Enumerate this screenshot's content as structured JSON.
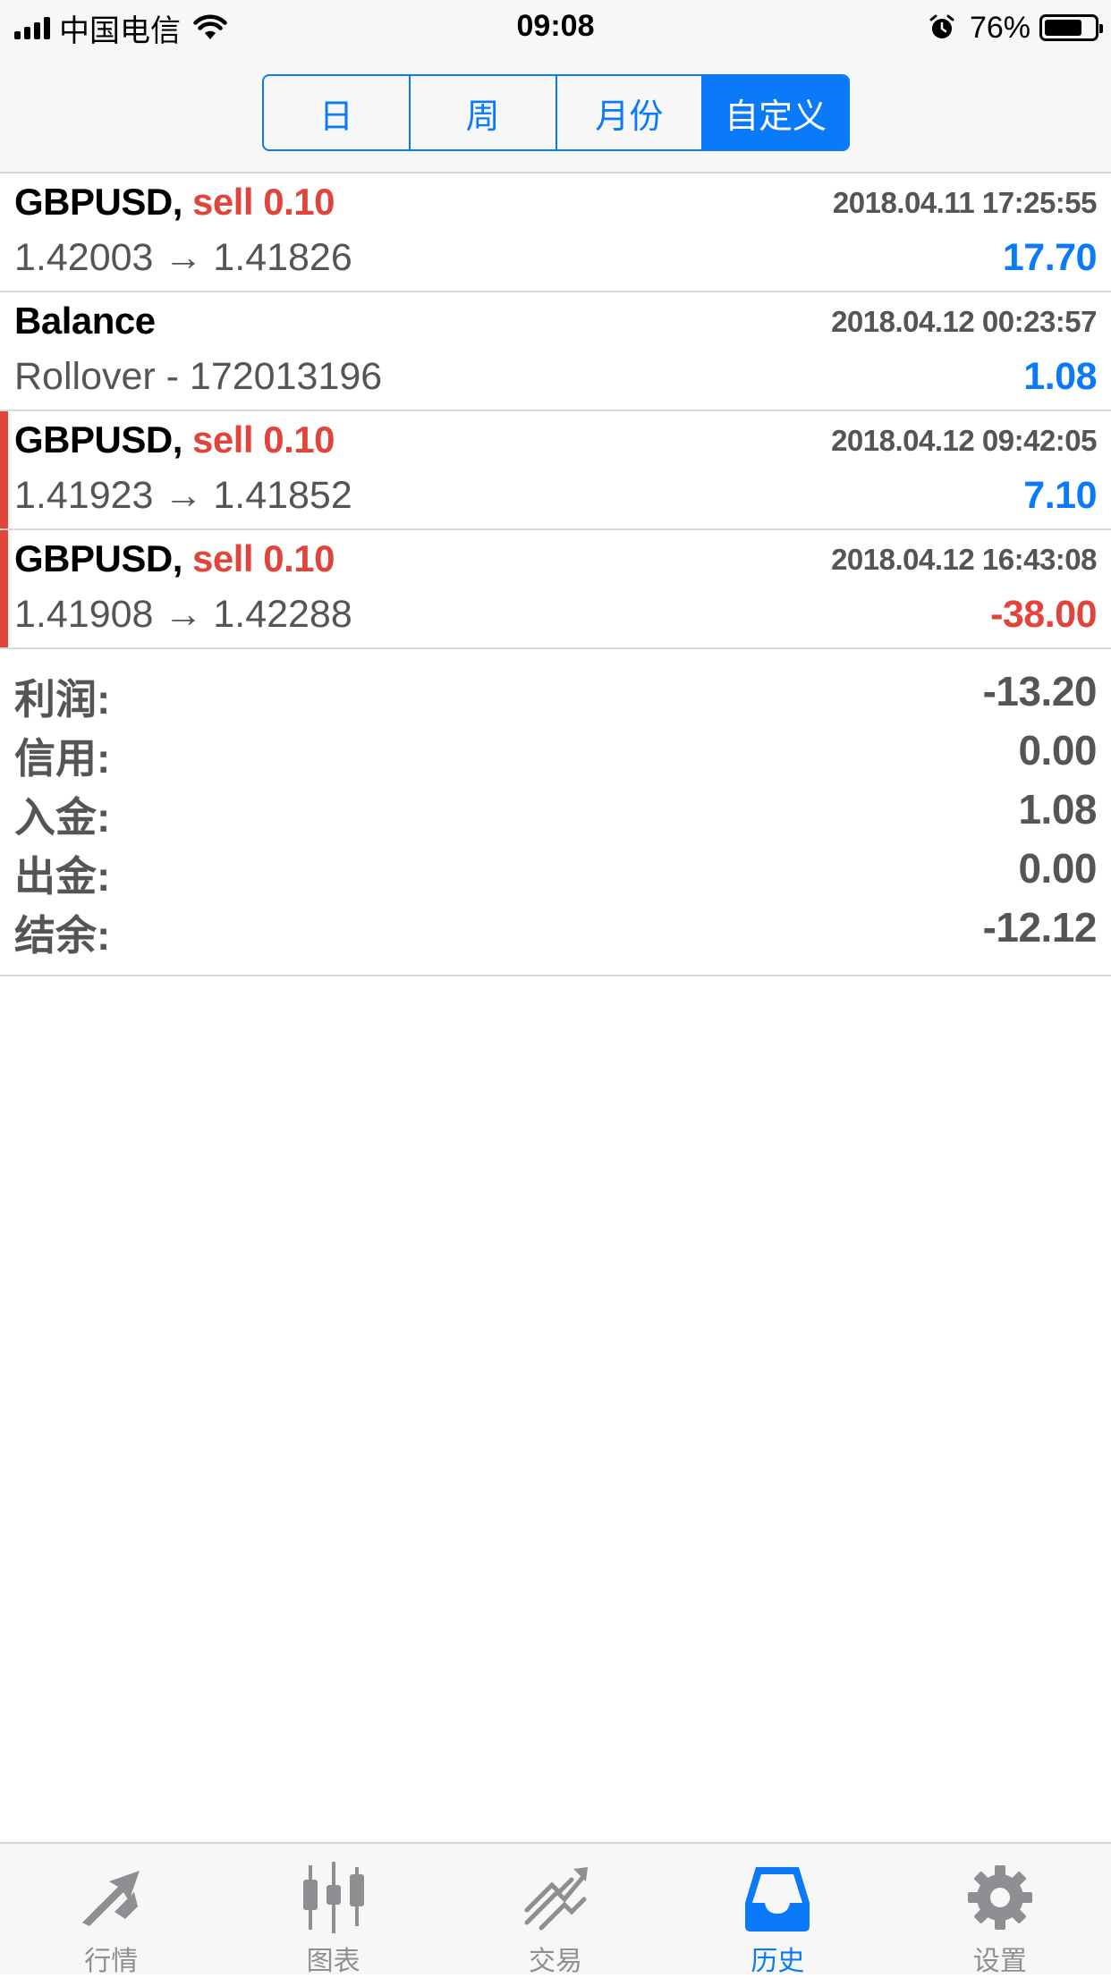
{
  "status_bar": {
    "carrier": "中国电信",
    "time": "09:08",
    "battery_percent": "76%",
    "battery_level": 0.76,
    "icons": [
      "signal-icon",
      "wifi-icon",
      "alarm-icon",
      "battery-icon"
    ]
  },
  "period_tabs": [
    {
      "label": "日",
      "active": false
    },
    {
      "label": "周",
      "active": false
    },
    {
      "label": "月份",
      "active": false
    },
    {
      "label": "自定义",
      "active": true
    }
  ],
  "deals": [
    {
      "symbol": "GBPUSD,",
      "side": "sell 0.10",
      "time": "2018.04.11 17:25:55",
      "detail": "1.42003 → 1.41826",
      "profit": "17.70",
      "profit_sign": "positive",
      "marked": false
    },
    {
      "symbol": "Balance",
      "side": "",
      "time": "2018.04.12 00:23:57",
      "detail": "Rollover - 172013196",
      "profit": "1.08",
      "profit_sign": "positive",
      "marked": false
    },
    {
      "symbol": "GBPUSD,",
      "side": "sell 0.10",
      "time": "2018.04.12 09:42:05",
      "detail": "1.41923 → 1.41852",
      "profit": "7.10",
      "profit_sign": "positive",
      "marked": true
    },
    {
      "symbol": "GBPUSD,",
      "side": "sell 0.10",
      "time": "2018.04.12 16:43:08",
      "detail": "1.41908 → 1.42288",
      "profit": "-38.00",
      "profit_sign": "negative",
      "marked": true
    }
  ],
  "summary": [
    {
      "label": "利润:",
      "value": "-13.20"
    },
    {
      "label": "信用:",
      "value": "0.00"
    },
    {
      "label": "入金:",
      "value": "1.08"
    },
    {
      "label": "出金:",
      "value": "0.00"
    },
    {
      "label": "结余:",
      "value": "-12.12"
    }
  ],
  "tab_bar": [
    {
      "label": "行情",
      "icon": "quotes-icon",
      "active": false
    },
    {
      "label": "图表",
      "icon": "chart-icon",
      "active": false
    },
    {
      "label": "交易",
      "icon": "trade-icon",
      "active": false
    },
    {
      "label": "历史",
      "icon": "history-icon",
      "active": true
    },
    {
      "label": "设置",
      "icon": "gear-icon",
      "active": false
    }
  ],
  "colors": {
    "accent": "#0a7af9",
    "negative": "#e0443b",
    "inactive_icon": "#8e8e93",
    "muted_text": "#555555"
  }
}
